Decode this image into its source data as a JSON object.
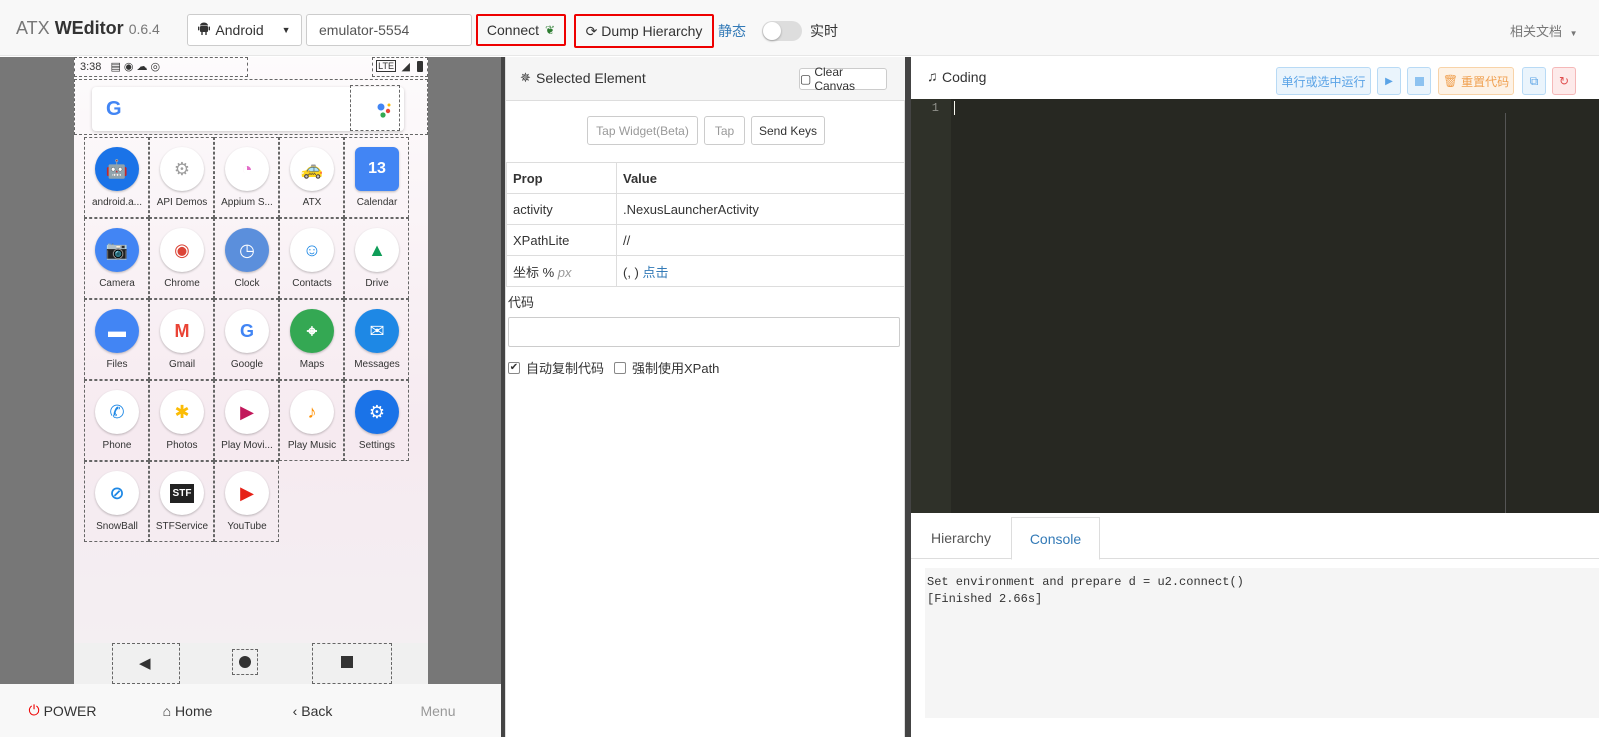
{
  "header": {
    "brand_prefix": "ATX",
    "brand_name": "WEditor",
    "version": "0.6.4",
    "platform_select": "Android",
    "device_input": "emulator-5554",
    "connect_label": "Connect",
    "dump_label": "Dump Hierarchy",
    "static_label": "静态",
    "realtime_label": "实时",
    "docs_label": "相关文档"
  },
  "phone": {
    "time": "3:38",
    "net": "LTE",
    "apps": [
      {
        "label": "android.a...",
        "icon": "android-icon",
        "color": "#1a73e8"
      },
      {
        "label": "API Demos",
        "icon": "folder-gear-icon",
        "color": "#9e9e9e"
      },
      {
        "label": "Appium S...",
        "icon": "appium-icon",
        "color": "#e36bc8"
      },
      {
        "label": "ATX",
        "icon": "taxi-icon",
        "color": "#fbc02d"
      },
      {
        "label": "Calendar",
        "icon": "calendar-icon",
        "color": "#4285f4",
        "text": "13"
      },
      {
        "label": "Camera",
        "icon": "camera-icon",
        "color": "#4285f4"
      },
      {
        "label": "Chrome",
        "icon": "chrome-icon",
        "color": "#db4437"
      },
      {
        "label": "Clock",
        "icon": "clock-icon",
        "color": "#5b8fdc"
      },
      {
        "label": "Contacts",
        "icon": "contacts-icon",
        "color": "#1e88e5"
      },
      {
        "label": "Drive",
        "icon": "drive-icon",
        "color": "#0f9d58"
      },
      {
        "label": "Files",
        "icon": "files-icon",
        "color": "#4285f4"
      },
      {
        "label": "Gmail",
        "icon": "gmail-icon",
        "color": "#ea4335"
      },
      {
        "label": "Google",
        "icon": "google-icon",
        "color": "#4285f4"
      },
      {
        "label": "Maps",
        "icon": "maps-icon",
        "color": "#34a853"
      },
      {
        "label": "Messages",
        "icon": "messages-icon",
        "color": "#1e88e5"
      },
      {
        "label": "Phone",
        "icon": "phone-icon",
        "color": "#1e88e5"
      },
      {
        "label": "Photos",
        "icon": "photos-icon",
        "color": "#fbbc05"
      },
      {
        "label": "Play Movi...",
        "icon": "play-movies-icon",
        "color": "#c2185b"
      },
      {
        "label": "Play Music",
        "icon": "play-music-icon",
        "color": "#ff8f00"
      },
      {
        "label": "Settings",
        "icon": "settings-icon",
        "color": "#1a73e8"
      },
      {
        "label": "SnowBall",
        "icon": "snowball-icon",
        "color": "#1e88e5"
      },
      {
        "label": "STFService",
        "icon": "stf-icon",
        "color": "#222222",
        "text": "STF"
      },
      {
        "label": "YouTube",
        "icon": "youtube-icon",
        "color": "#e62117"
      }
    ]
  },
  "bottom": {
    "power": "POWER",
    "home": "Home",
    "back": "Back",
    "menu": "Menu"
  },
  "middle": {
    "title": "Selected Element",
    "clear_canvas": "Clear Canvas",
    "tap_widget": "Tap Widget(Beta)",
    "tap": "Tap",
    "send_keys": "Send Keys",
    "table_header": {
      "prop": "Prop",
      "value": "Value"
    },
    "rows": [
      {
        "prop": "activity",
        "value": ".NexusLauncherActivity"
      },
      {
        "prop": "XPathLite",
        "value": "//"
      }
    ],
    "coord_prop": "坐标 %",
    "coord_unit": "px",
    "coord_value": "(, )",
    "coord_link": "点击",
    "code_label": "代码",
    "auto_copy": "自动复制代码",
    "force_xpath": "强制使用XPath"
  },
  "right": {
    "title": "Coding",
    "run_label": "单行或选中运行",
    "reset_label": "重置代码",
    "line_no": "1",
    "tab_hierarchy": "Hierarchy",
    "tab_console": "Console",
    "console_text": "Set environment and prepare d = u2.connect()\n[Finished 2.66s]"
  },
  "colors": {
    "accent": "#337ab7",
    "highlight_border": "#e00000",
    "editor_bg": "#272822"
  }
}
